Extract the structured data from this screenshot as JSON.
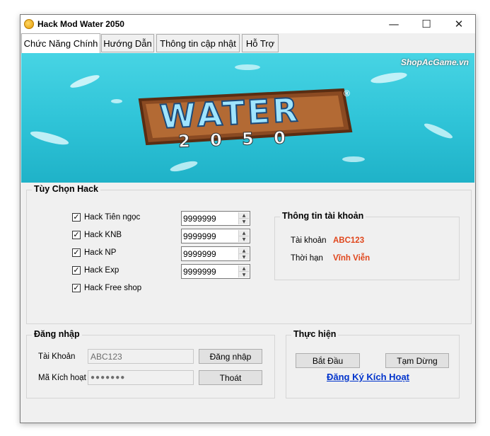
{
  "window": {
    "title": "Hack Mod Water 2050",
    "controls": {
      "minimize": "—",
      "maximize": "☐",
      "close": "✕"
    }
  },
  "tabs": [
    {
      "label": "Chức Năng Chính",
      "active": true
    },
    {
      "label": "Hướng Dẫn",
      "active": false
    },
    {
      "label": "Thông tin cập nhật",
      "active": false
    },
    {
      "label": "Hỗ Trợ",
      "active": false
    }
  ],
  "banner": {
    "watermark": "ShopAcGame.vn",
    "logo_word": "WATER",
    "logo_registered": "®",
    "logo_year": "2 0 5 0"
  },
  "hack_options": {
    "title": "Tùy Chọn Hack",
    "items": [
      {
        "label": "Hack Tiên ngọc",
        "checked": true,
        "value": "9999999"
      },
      {
        "label": "Hack KNB",
        "checked": true,
        "value": "9999999"
      },
      {
        "label": "Hack NP",
        "checked": true,
        "value": "9999999"
      },
      {
        "label": "Hack Exp",
        "checked": true,
        "value": "9999999"
      },
      {
        "label": "Hack Free shop",
        "checked": true
      }
    ],
    "check_mark": "✓",
    "spin_up": "▲",
    "spin_down": "▼"
  },
  "account_info": {
    "title": "Thông tin tài khoản",
    "account_label": "Tài khoản",
    "account_value": "ABC123",
    "term_label": "Thời hạn",
    "term_value": "Vĩnh Viễn",
    "value_color": "#e0461c"
  },
  "login": {
    "title": "Đăng nhập",
    "account_label": "Tài Khoản",
    "account_value": "ABC123",
    "activation_label": "Mã Kích hoạt",
    "activation_value": "●●●●●●●",
    "login_button": "Đăng nhập",
    "exit_button": "Thoát"
  },
  "actions": {
    "title": "Thực hiện",
    "start_button": "Bắt Đầu",
    "pause_button": "Tạm Dừng",
    "register_link": "Đăng Ký Kích Hoạt"
  }
}
